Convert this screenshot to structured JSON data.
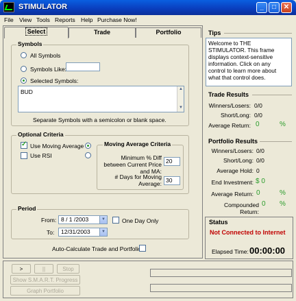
{
  "window": {
    "title": "STIMULATOR"
  },
  "menu": [
    "File",
    "View",
    "Tools",
    "Reports",
    "Help",
    "Purchase Now!"
  ],
  "tabs": {
    "select": "Select",
    "trade": "Trade",
    "portfolio": "Portfolio"
  },
  "symbols": {
    "title": "Symbols",
    "all_symbols": "All Symbols",
    "symbols_like": "Symbols Like:",
    "selected_symbols": "Selected Symbols:",
    "list_value": "BUD",
    "help_text": "Separate Symbols with a semicolon or blank space."
  },
  "optional": {
    "title": "Optional Criteria",
    "use_ma": "Use Moving Average",
    "use_rsi": "Use RSI"
  },
  "ma": {
    "title": "Moving Average Criteria",
    "pct_label": "Minimum % Diff between Current Price and MA:",
    "pct_value": "20",
    "days_label": "# Days for Moving Average:",
    "days_value": "30"
  },
  "period": {
    "title": "Period",
    "from_label": "From:",
    "from_value": "8 / 1 /2003",
    "to_label": "To:",
    "to_value": "12/31/2003",
    "one_day_only": "One Day Only"
  },
  "auto_calc": "Auto-Calculate Trade and Portfolio",
  "tips": {
    "title": "Tips",
    "text": "Welcome to THE STIMULATOR. This frame displays context-sensitive information. Click on any control to learn more about what that control does."
  },
  "trade_results": {
    "title": "Trade Results",
    "winners_losers_label": "Winners/Losers:",
    "winners_losers_value": "0/0",
    "short_long_label": "Short/Long:",
    "short_long_value": "0/0",
    "avg_return_label": "Average Return:",
    "avg_return_value": "0",
    "avg_return_unit": "%"
  },
  "portfolio_results": {
    "title": "Portfolio Results",
    "winners_losers_label": "Winners/Losers:",
    "winners_losers_value": "0/0",
    "short_long_label": "Short/Long:",
    "short_long_value": "0/0",
    "avg_hold_label": "Average Hold:",
    "avg_hold_value": "0",
    "end_inv_label": "End Investment:",
    "end_inv_value": "$ 0",
    "avg_return_label": "Average Return:",
    "avg_return_value": "0",
    "avg_return_unit": "%",
    "comp_return_label": "Compounded Return:",
    "comp_return_value": "0",
    "comp_return_unit": "%"
  },
  "status": {
    "title": "Status",
    "message": "Not Connected to Internet",
    "elapsed_label": "Elapsed Time:",
    "elapsed_value": "00:00:00"
  },
  "controls": {
    "play": ">",
    "pause": "||",
    "stop": "Stop",
    "smart": "Show S.M.A.R.T. Progress",
    "graph": "Graph Portfolio"
  }
}
